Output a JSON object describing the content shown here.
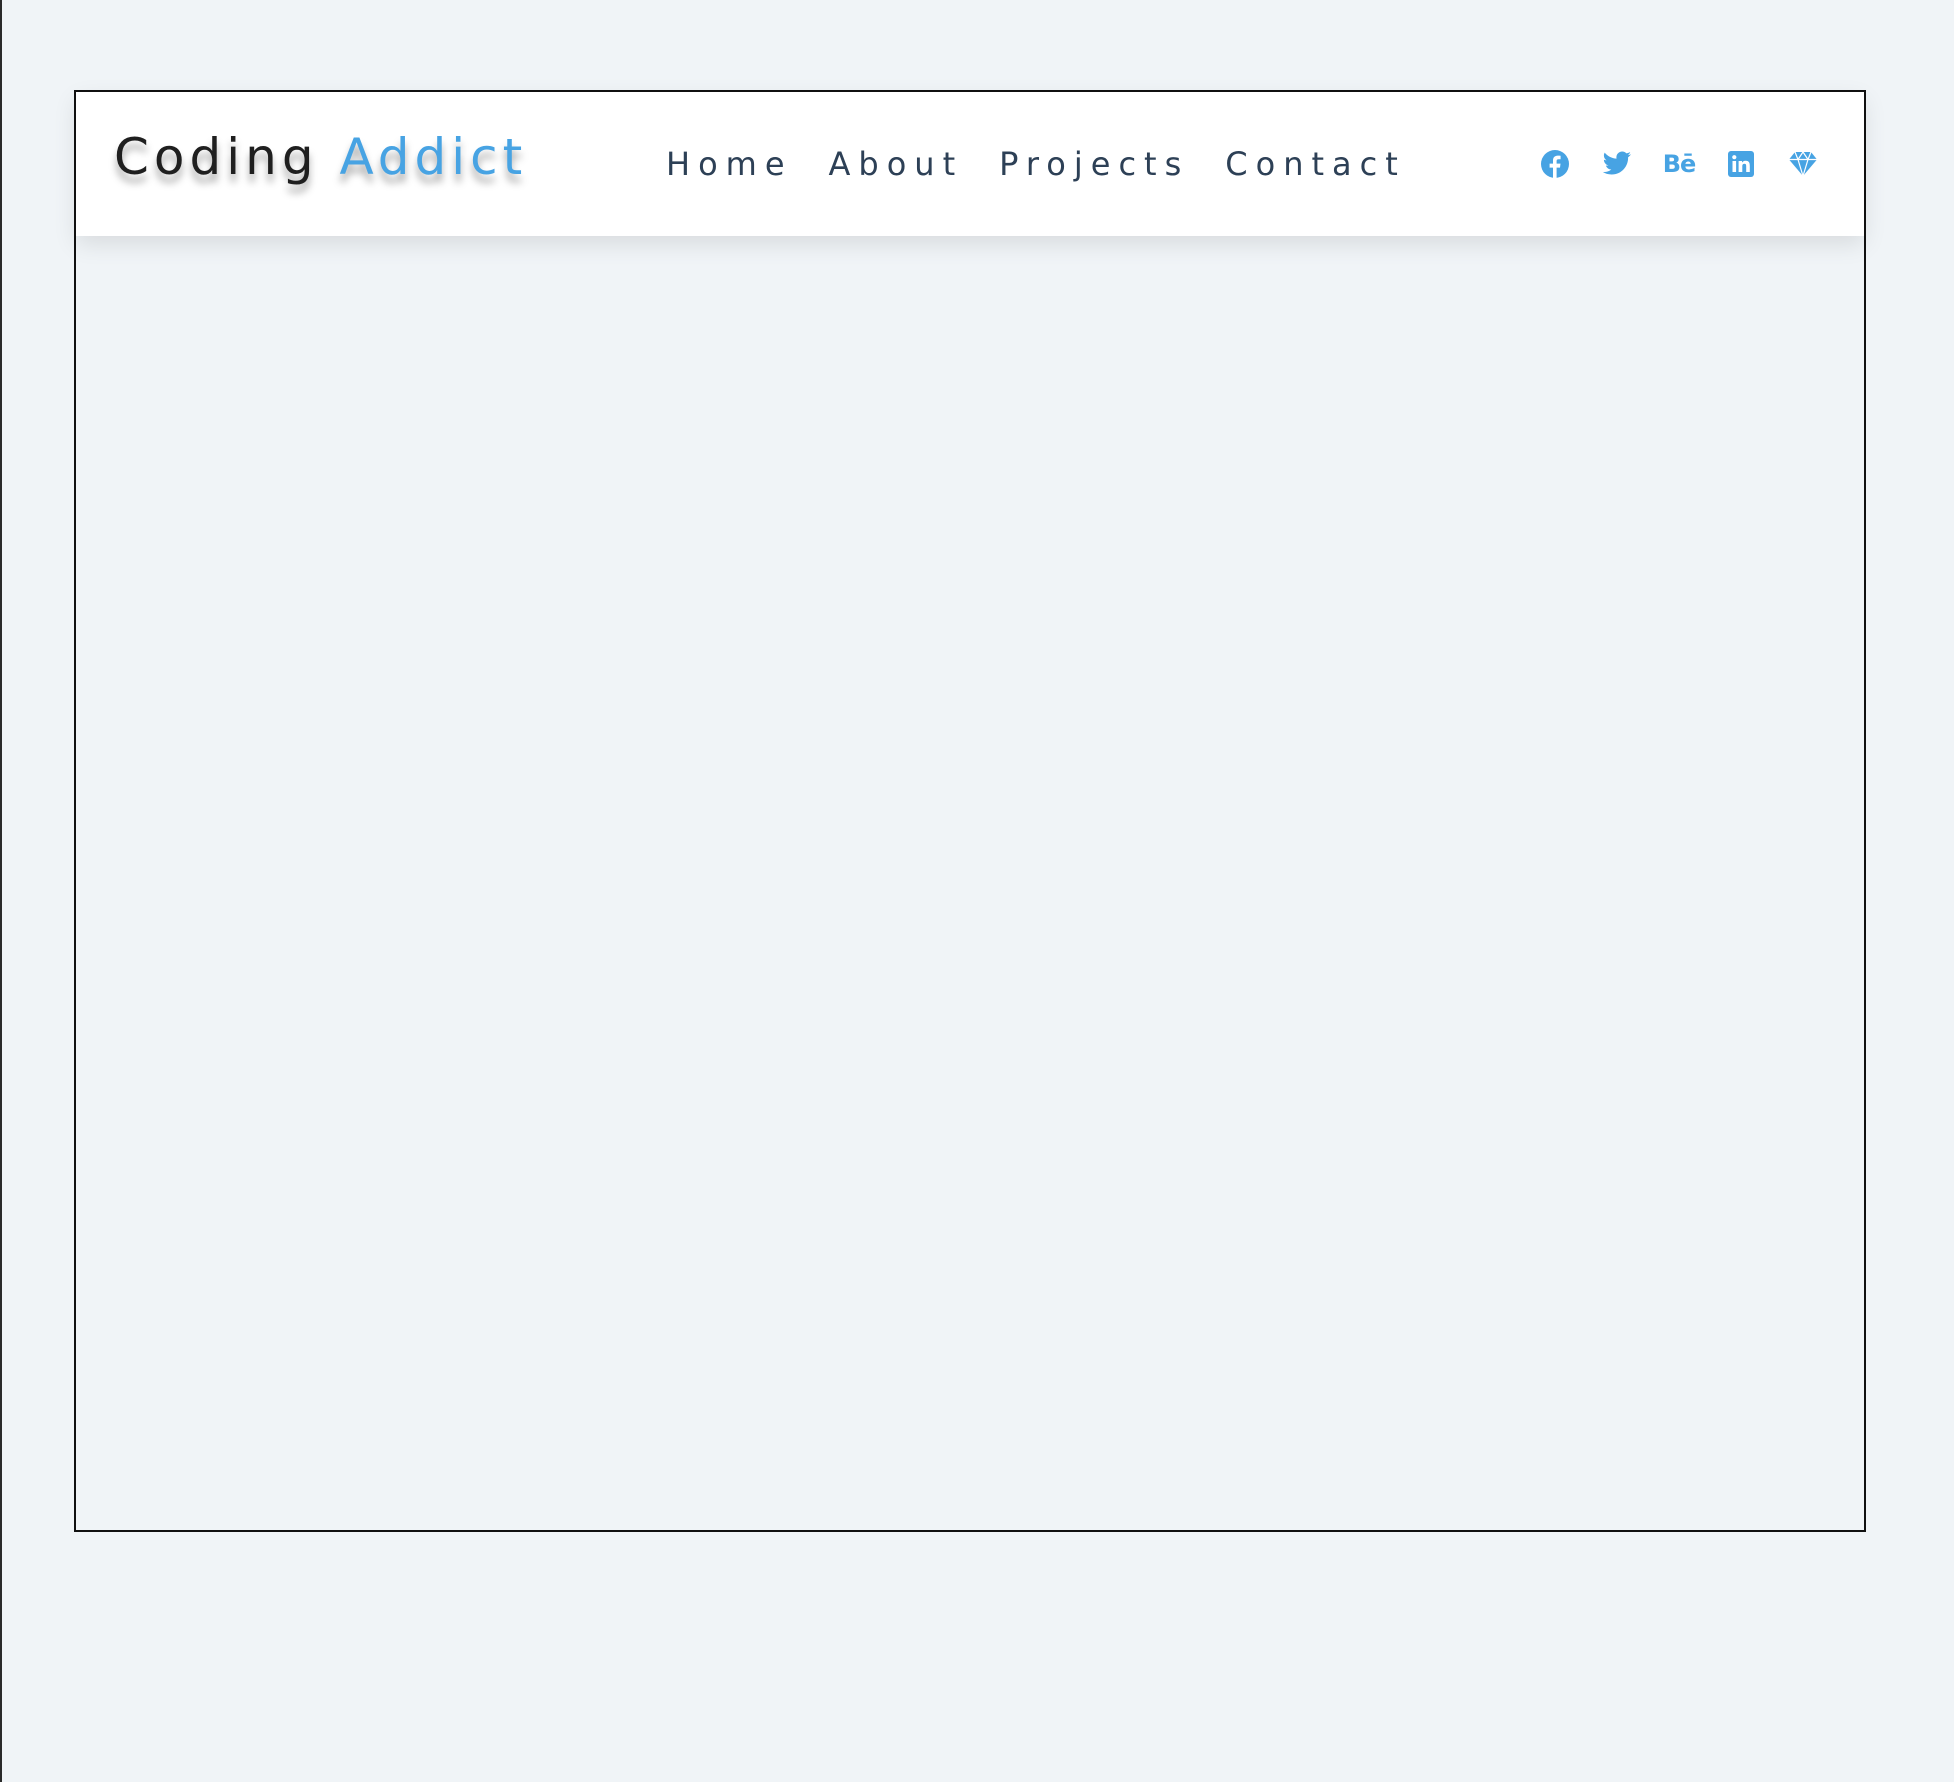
{
  "logo": {
    "word1": "Coding",
    "word2": "Addict"
  },
  "nav": {
    "items": [
      {
        "label": "Home"
      },
      {
        "label": "About"
      },
      {
        "label": "Projects"
      },
      {
        "label": "Contact"
      }
    ]
  },
  "social": {
    "icons": [
      "facebook-icon",
      "twitter-icon",
      "behance-icon",
      "linkedin-icon",
      "sketch-icon"
    ],
    "behance_text": "Bē"
  },
  "colors": {
    "accent": "#47a3e3",
    "text_dark": "#1f1f1f",
    "nav_text": "#2d4056",
    "background": "#f0f4f7",
    "navbar_bg": "#ffffff"
  }
}
